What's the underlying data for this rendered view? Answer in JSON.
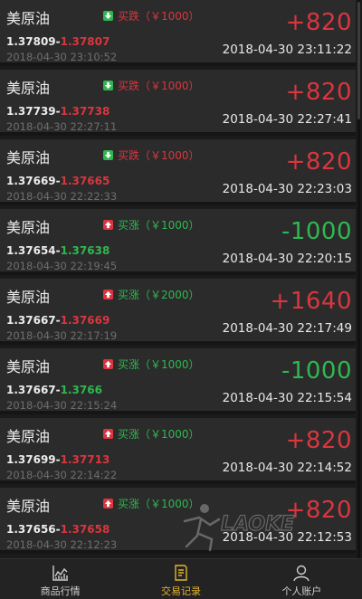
{
  "colors": {
    "background": "#1b1b1b",
    "card": "#2b2b2b",
    "profit_red": "#d9363f",
    "loss_green": "#2fb84f",
    "active_tab": "#e2b430"
  },
  "trades": [
    {
      "name": "美原油",
      "direction": "买跌（￥1000）",
      "direction_type": "down",
      "open_price": "1.37809",
      "close_price": "1.37807",
      "close_color": "red",
      "open_time": "2018-04-30 23:10:52",
      "pl": "+820",
      "pl_color": "red",
      "close_time": "2018-04-30 23:11:22"
    },
    {
      "name": "美原油",
      "direction": "买跌（￥1000）",
      "direction_type": "down",
      "open_price": "1.37739",
      "close_price": "1.37738",
      "close_color": "red",
      "open_time": "2018-04-30 22:27:11",
      "pl": "+820",
      "pl_color": "red",
      "close_time": "2018-04-30 22:27:41"
    },
    {
      "name": "美原油",
      "direction": "买跌（￥1000）",
      "direction_type": "down",
      "open_price": "1.37669",
      "close_price": "1.37665",
      "close_color": "red",
      "open_time": "2018-04-30 22:22:33",
      "pl": "+820",
      "pl_color": "red",
      "close_time": "2018-04-30 22:23:03"
    },
    {
      "name": "美原油",
      "direction": "买涨（￥1000）",
      "direction_type": "up",
      "open_price": "1.37654",
      "close_price": "1.37638",
      "close_color": "green",
      "open_time": "2018-04-30 22:19:45",
      "pl": "-1000",
      "pl_color": "green",
      "close_time": "2018-04-30 22:20:15"
    },
    {
      "name": "美原油",
      "direction": "买涨（￥2000）",
      "direction_type": "up",
      "open_price": "1.37667",
      "close_price": "1.37669",
      "close_color": "red",
      "open_time": "2018-04-30 22:17:19",
      "pl": "+1640",
      "pl_color": "red",
      "close_time": "2018-04-30 22:17:49"
    },
    {
      "name": "美原油",
      "direction": "买涨（￥1000）",
      "direction_type": "up",
      "open_price": "1.37667",
      "close_price": "1.3766",
      "close_color": "green",
      "open_time": "2018-04-30 22:15:24",
      "pl": "-1000",
      "pl_color": "green",
      "close_time": "2018-04-30 22:15:54"
    },
    {
      "name": "美原油",
      "direction": "买涨（￥1000）",
      "direction_type": "up",
      "open_price": "1.37699",
      "close_price": "1.37713",
      "close_color": "red",
      "open_time": "2018-04-30 22:14:22",
      "pl": "+820",
      "pl_color": "red",
      "close_time": "2018-04-30 22:14:52"
    },
    {
      "name": "美原油",
      "direction": "买涨（￥1000）",
      "direction_type": "up",
      "open_price": "1.37656",
      "close_price": "1.37658",
      "close_color": "red",
      "open_time": "2018-04-30 22:12:23",
      "pl": "+820",
      "pl_color": "red",
      "close_time": "2018-04-30 22:12:53"
    }
  ],
  "price_separator": "-",
  "watermark": {
    "text": "LAOKE",
    "icon": "running-figure-logo"
  },
  "tabs": [
    {
      "label": "商品行情",
      "icon": "chart-icon",
      "active": false
    },
    {
      "label": "交易记录",
      "icon": "document-icon",
      "active": true
    },
    {
      "label": "个人账户",
      "icon": "user-icon",
      "active": false
    }
  ]
}
